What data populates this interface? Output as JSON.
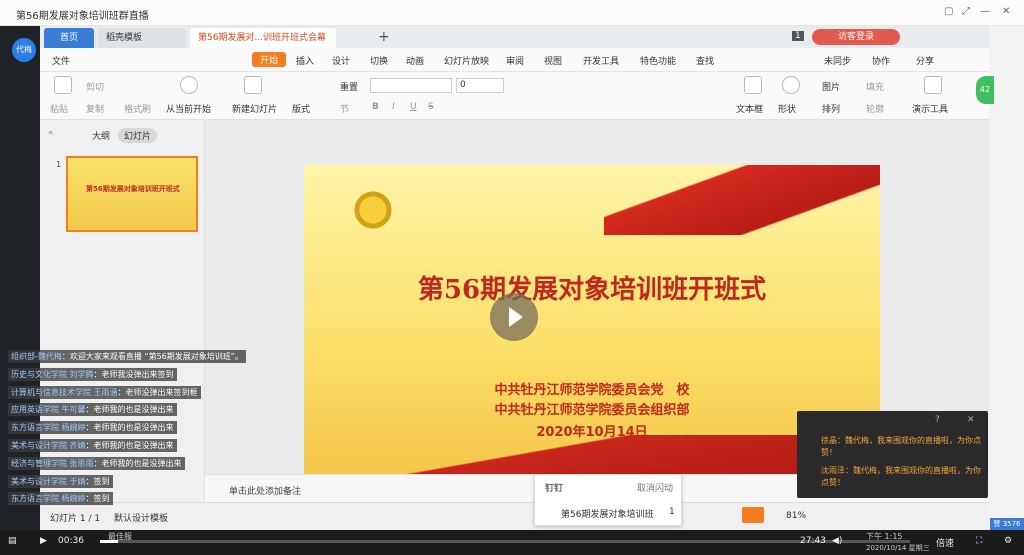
{
  "window": {
    "title": "第56期发展对象培训班群直播"
  },
  "avatar": {
    "label": "代梅"
  },
  "tabs": {
    "home": "首页",
    "template": "稻壳模板",
    "doc": "第56期发展对...训班开班式会幕",
    "page_count": "1",
    "visitor": "访客登录"
  },
  "menu": {
    "file": "文件",
    "start": "开始",
    "insert": "插入",
    "design": "设计",
    "switch": "切换",
    "animation": "动画",
    "slideshow": "幻灯片放映",
    "review": "审阅",
    "view": "视图",
    "dev": "开发工具",
    "special": "特色功能",
    "search": "查找",
    "unsync": "未同步",
    "collab": "协作",
    "share": "分享"
  },
  "ribbon": {
    "paste": "粘贴",
    "cut": "剪切",
    "copy": "复制",
    "format_painter": "格式刷",
    "from_current": "从当前开始",
    "new_slide": "新建幻灯片",
    "layout": "版式",
    "section": "节",
    "reset": "重置",
    "font_size": "0",
    "textbox": "文本框",
    "shape": "形状",
    "picture": "图片",
    "fill": "填充",
    "arrange": "排列",
    "outline": "轮廓",
    "present_tools": "演示工具",
    "green_badge": "42"
  },
  "left_panel": {
    "outline_tab": "大纲",
    "slides_tab": "幻灯片",
    "slide_num": "1",
    "thumb_title": "第56期发展对象培训班开班式"
  },
  "slide": {
    "title": "第56期发展对象培训班开班式",
    "line1": "中共牡丹江师范学院委员会党　校",
    "line2": "中共牡丹江师范学院委员会组织部",
    "line3": "2020年10月14日"
  },
  "notes": {
    "placeholder": "单击此处添加备注"
  },
  "status": {
    "slide_counter": "幻灯片 1 / 1",
    "theme": "默认设计模板",
    "zoom": "81%"
  },
  "comments": [
    {
      "who": "组织部-魏代梅",
      "text": "：欢迎大家来观看直播 “第56期发展对象培训班”。"
    },
    {
      "who": "历史与文化学院 刘学腾",
      "text": "：老师我没弹出来签到"
    },
    {
      "who": "计算机与信息技术学院 王雨涵",
      "text": "：老师没弹出来签到框"
    },
    {
      "who": "应用英语学院 牛可馨",
      "text": "：老师我的也是没弹出来"
    },
    {
      "who": "东方语言学院 杨婉婷",
      "text": "：老师我的也是没弹出来"
    },
    {
      "who": "美术与设计学院 齐婧",
      "text": "：老师我的也是没弹出来"
    },
    {
      "who": "经济与管理学院 张思雨",
      "text": "：老师我的也是没弹出来"
    },
    {
      "who": "美术与设计学院 于婧",
      "text": "：签到"
    },
    {
      "who": "东方语言学院 杨婉婷",
      "text": "：签到"
    }
  ],
  "live_popup": {
    "msg1": "徐晶：魏代梅，我来围观你的直播啦，为你点赞！",
    "msg2": "沈雨泽：魏代梅，我来围观你的直播啦，为你点赞！"
  },
  "dingding_popup": {
    "brand": "钉钉",
    "cancel": "取消闪动",
    "item": "第56期发展对象培训班",
    "count": "1"
  },
  "player": {
    "current_time": "00:36",
    "duration": "27:43",
    "speed": "倍速",
    "clock_time": "下午 1:15",
    "clock_date": "2020/10/14 星期三",
    "viewers": "赞 3576",
    "taskbar_item": "最佳服",
    "progress": 0.022
  }
}
